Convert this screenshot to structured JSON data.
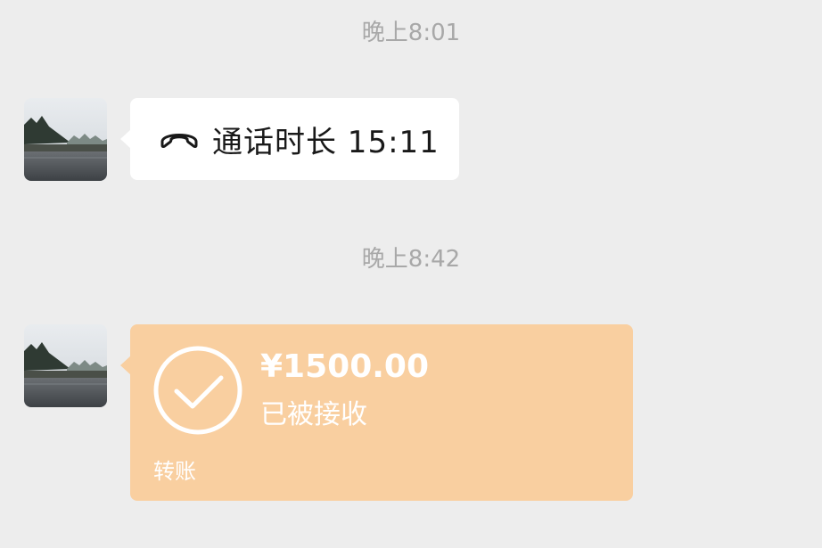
{
  "messages": {
    "time_1": "晚上8:01",
    "call": {
      "icon": "phone-hangup-icon",
      "text": "通话时长 15:11"
    },
    "time_2": "晚上8:42",
    "transfer": {
      "icon": "check-circle-icon",
      "amount": "¥1500.00",
      "status": "已被接收",
      "label": "转账"
    }
  },
  "colors": {
    "background": "#ededed",
    "bubble_white": "#ffffff",
    "transfer_bubble": "#f9cfa0",
    "timestamp_text": "#a8a8a8",
    "message_text": "#191919"
  }
}
